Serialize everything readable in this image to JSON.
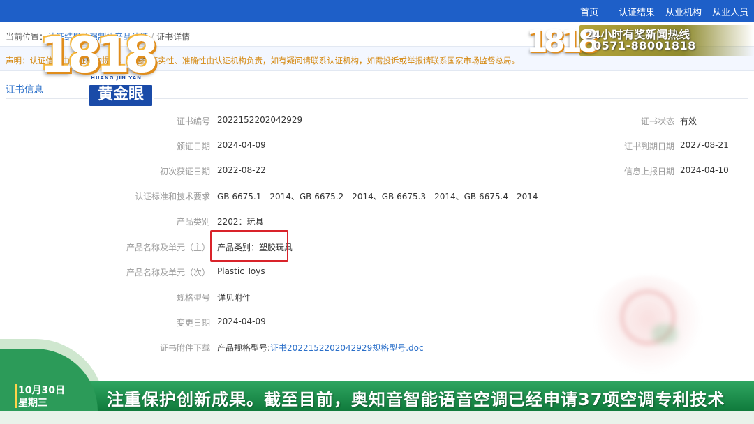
{
  "topnav": {
    "items": [
      "首页",
      "认证结果",
      "从业机构",
      "从业人员"
    ]
  },
  "breadcrumb": {
    "prefix": "当前位置：",
    "items": [
      "认证结果",
      "强制性产品认证",
      "证书详情"
    ]
  },
  "notice": {
    "text": "声明：认证信息由认证机构提供，数据的真实性、准确性由认证机构负责，如有疑问请联系认证机构，如需投诉或举报请联系国家市场监督总局。"
  },
  "section": {
    "title": "证书信息"
  },
  "fields_left": [
    {
      "label": "证书编号",
      "value": "2022152202042929"
    },
    {
      "label": "颁证日期",
      "value": "2024-04-09"
    },
    {
      "label": "初次获证日期",
      "value": "2022-08-22"
    },
    {
      "label": "认证标准和技术要求",
      "value": "GB 6675.1—2014、GB 6675.2—2014、GB 6675.3—2014、GB 6675.4—2014"
    },
    {
      "label": "产品类别",
      "value": "2202：玩具"
    },
    {
      "label": "产品名称及单元（主）",
      "value": "产品类别：塑胶玩具"
    },
    {
      "label": "产品名称及单元（次）",
      "value": "Plastic Toys"
    },
    {
      "label": "规格型号",
      "value": "详见附件"
    },
    {
      "label": "变更日期",
      "value": "2024-04-09"
    },
    {
      "label": "证书附件下载",
      "value": "产品规格型号:",
      "link": "证书2022152202042929规格型号.doc"
    }
  ],
  "fields_right": [
    {
      "label": "证书状态",
      "value": "有效"
    },
    {
      "label": "证书到期日期",
      "value": "2027-08-21"
    },
    {
      "label": "信息上报日期",
      "value": "2024-04-10"
    }
  ],
  "overlay": {
    "logo_digits": "1818",
    "logo_pinyin": "HUANG JIN YAN",
    "logo_name": "黄金眼",
    "hotline_title": "24小时有奖新闻热线",
    "hotline_number": "0571-88001818"
  },
  "ticker": {
    "date": "10月30日",
    "weekday": "星期三",
    "text": "注重保护创新成果。截至目前，奥知音智能语音空调已经申请37项空调专利技术"
  },
  "colors": {
    "nav_bg": "#1e5fc8",
    "link": "#2a6fc9",
    "notice_text": "#d4860b",
    "highlight": "#d9232a",
    "ticker_bg": "#1a8b49"
  }
}
